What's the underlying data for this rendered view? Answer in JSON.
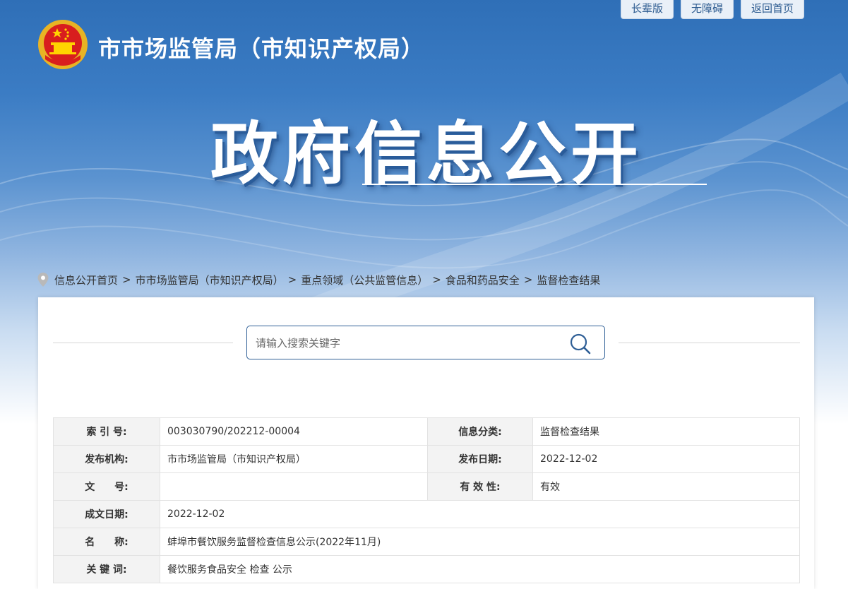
{
  "top_buttons": [
    "长辈版",
    "无障碍",
    "返回首页"
  ],
  "header": {
    "org_title": "市市场监管局（市知识产权局）",
    "main_title": "政府信息公开"
  },
  "breadcrumb": [
    "信息公开首页",
    "市市场监管局（市知识产权局）",
    "重点领域（公共监管信息）",
    "食品和药品安全",
    "监督检查结果"
  ],
  "breadcrumb_sep": ">",
  "search": {
    "placeholder": "请输入搜索关键字"
  },
  "meta": {
    "index_label": "索 引 号:",
    "index_value": "003030790/202212-00004",
    "category_label": "信息分类:",
    "category_value": "监督检查结果",
    "publisher_label": "发布机构:",
    "publisher_value": "市市场监管局（市知识产权局）",
    "pubdate_label": "发布日期:",
    "pubdate_value": "2022-12-02",
    "docno_label": "文　　号:",
    "docno_value": "",
    "validity_label": "有 效 性:",
    "validity_value": "有效",
    "created_label": "成文日期:",
    "created_value": "2022-12-02",
    "name_label": "名　　称:",
    "name_value": "蚌埠市餐饮服务监督检查信息公示(2022年11月)",
    "keywords_label": "关 键 词:",
    "keywords_value": "餐饮服务食品安全 检查 公示"
  },
  "colors": {
    "banner_blue": "#3b7cc4",
    "border_blue": "#2f5f96"
  },
  "icons": [
    "national-emblem-icon",
    "location-pin-icon",
    "search-icon"
  ]
}
